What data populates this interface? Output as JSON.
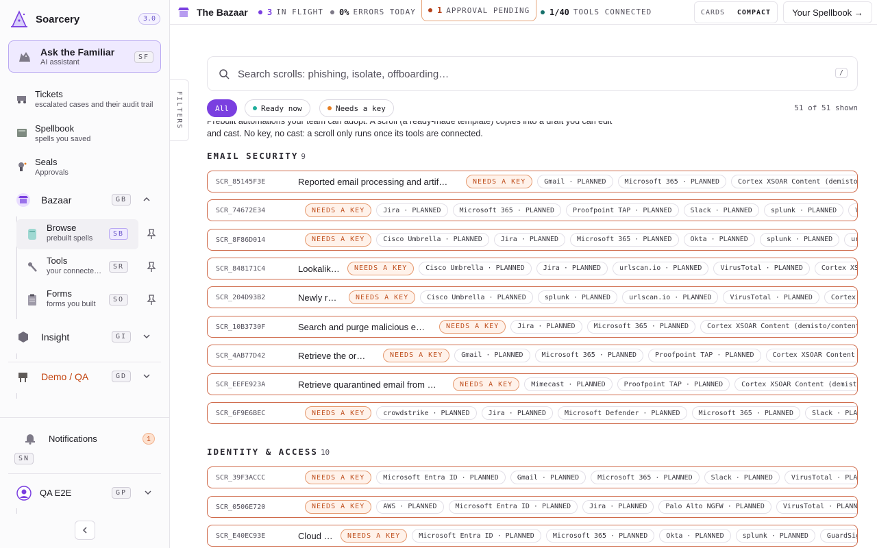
{
  "sidebar": {
    "brand": "Soarcery",
    "version": "3.0",
    "familiar": {
      "title": "Ask the Familiar",
      "subtitle": "AI assistant",
      "kbd": "SF"
    },
    "items": [
      {
        "title": "Tickets",
        "subtitle": "escalated cases and their audit trail"
      },
      {
        "title": "Spellbook",
        "subtitle": "spells you saved"
      },
      {
        "title": "Seals",
        "subtitle": "Approvals"
      }
    ],
    "bazaar": {
      "title": "Bazaar",
      "kbd": "GB"
    },
    "bazaar_sub": [
      {
        "title": "Browse",
        "subtitle": "prebuilt spells",
        "kbd": "SB"
      },
      {
        "title": "Tools",
        "subtitle": "your connecte…",
        "kbd": "SR"
      },
      {
        "title": "Forms",
        "subtitle": "forms you built",
        "kbd": "SO"
      }
    ],
    "insight": {
      "title": "Insight",
      "kbd": "GI"
    },
    "demo": {
      "title": "Demo / QA",
      "kbd": "GD"
    },
    "notifications": {
      "title": "Notifications",
      "count": "1",
      "kbd": "SN"
    },
    "user": {
      "name": "QA E2E",
      "kbd": "GP"
    }
  },
  "topbar": {
    "title": "The Bazaar",
    "in_flight": {
      "value": "3",
      "label": "IN FLIGHT"
    },
    "errors": {
      "value": "0%",
      "label": "ERRORS TODAY"
    },
    "pending": {
      "value": "1",
      "label": "APPROVAL PENDING"
    },
    "tools": {
      "value": "1/40",
      "label": "TOOLS CONNECTED"
    },
    "view_cards": "CARDS",
    "view_compact": "COMPACT",
    "spellbook_btn": "Your Spellbook →"
  },
  "filters_label": "FILTERS",
  "search": {
    "placeholder": "Search scrolls: phishing, isolate, offboarding…",
    "shortcut": "/"
  },
  "chips": {
    "all": "All",
    "ready": "Ready now",
    "needs": "Needs a key"
  },
  "shown": "51 of 51 shown",
  "intro": {
    "line1": "Prebuilt automations your team can adopt. A scroll (a ready-made template) copies into a draft you can edit",
    "line2": "and cast. No key, no cast: a scroll only runs once its tools are connected."
  },
  "sections": [
    {
      "name": "EMAIL SECURITY",
      "count": "9",
      "rows": [
        {
          "id": "SCR_85145F3E",
          "title": "Reported email processing and artif…",
          "status": "NEEDS A KEY",
          "tools": [
            "Gmail · PLANNED",
            "Microsoft 365 · PLANNED",
            "Cortex XSOAR Content (demisto/content)"
          ]
        },
        {
          "id": "SCR_74672E34",
          "title": "",
          "status": "NEEDS A KEY",
          "tools": [
            "Jira · PLANNED",
            "Microsoft 365 · PLANNED",
            "Proofpoint TAP · PLANNED",
            "Slack · PLANNED",
            "splunk · PLANNED",
            "VirusTotal · PLANNED"
          ]
        },
        {
          "id": "SCR_8F86D014",
          "title": "",
          "status": "NEEDS A KEY",
          "tools": [
            "Cisco Umbrella · PLANNED",
            "Jira · PLANNED",
            "Microsoft 365 · PLANNED",
            "Okta · PLANNED",
            "splunk · PLANNED",
            "urlscan.io · PLANNED"
          ]
        },
        {
          "id": "SCR_848171C4",
          "title": "Lookalik…",
          "status": "NEEDS A KEY",
          "tools": [
            "Cisco Umbrella · PLANNED",
            "Jira · PLANNED",
            "urlscan.io · PLANNED",
            "VirusTotal · PLANNED",
            "Cortex XSOAR Content"
          ]
        },
        {
          "id": "SCR_204D93B2",
          "title": "Newly r…",
          "status": "NEEDS A KEY",
          "tools": [
            "Cisco Umbrella · PLANNED",
            "splunk · PLANNED",
            "urlscan.io · PLANNED",
            "VirusTotal · PLANNED",
            "Cortex XSOAR Content"
          ]
        },
        {
          "id": "SCR_10B3730F",
          "title": "Search and purge malicious e…",
          "status": "NEEDS A KEY",
          "tools": [
            "Jira · PLANNED",
            "Microsoft 365 · PLANNED",
            "Cortex XSOAR Content (demisto/content)"
          ]
        },
        {
          "id": "SCR_4AB77D42",
          "title": "Retrieve the or…",
          "status": "NEEDS A KEY",
          "tools": [
            "Gmail · PLANNED",
            "Microsoft 365 · PLANNED",
            "Proofpoint TAP · PLANNED",
            "Cortex XSOAR Content (demisto/content)"
          ]
        },
        {
          "id": "SCR_EEFE923A",
          "title": "Retrieve quarantined email from …",
          "status": "NEEDS A KEY",
          "tools": [
            "Mimecast · PLANNED",
            "Proofpoint TAP · PLANNED",
            "Cortex XSOAR Content (demisto/content)"
          ]
        },
        {
          "id": "SCR_6F9E6BEC",
          "title": "",
          "status": "NEEDS A KEY",
          "tools": [
            "crowdstrike · PLANNED",
            "Jira · PLANNED",
            "Microsoft Defender · PLANNED",
            "Microsoft 365 · PLANNED",
            "Slack · PLANNED"
          ]
        }
      ]
    },
    {
      "name": "IDENTITY & ACCESS",
      "count": "10",
      "rows": [
        {
          "id": "SCR_39F3ACCC",
          "title": "",
          "status": "NEEDS A KEY",
          "tools": [
            "Microsoft Entra ID · PLANNED",
            "Gmail · PLANNED",
            "Microsoft 365 · PLANNED",
            "Slack · PLANNED",
            "VirusTotal · PLANNED"
          ]
        },
        {
          "id": "SCR_0506E720",
          "title": "",
          "status": "NEEDS A KEY",
          "tools": [
            "AWS · PLANNED",
            "Microsoft Entra ID · PLANNED",
            "Jira · PLANNED",
            "Palo Alto NGFW · PLANNED",
            "VirusTotal · PLANNED"
          ]
        },
        {
          "id": "SCR_E40EC93E",
          "title": "Cloud …",
          "status": "NEEDS A KEY",
          "tools": [
            "Microsoft Entra ID · PLANNED",
            "Microsoft 365 · PLANNED",
            "Okta · PLANNED",
            "splunk · PLANNED",
            "GuardSight"
          ]
        }
      ]
    }
  ],
  "colors": {
    "accent": "#7a3fe0",
    "needs_key": "#c0501f",
    "ready": "#1fae9b",
    "warn": "#e67e22",
    "demo": "#c2410c"
  }
}
